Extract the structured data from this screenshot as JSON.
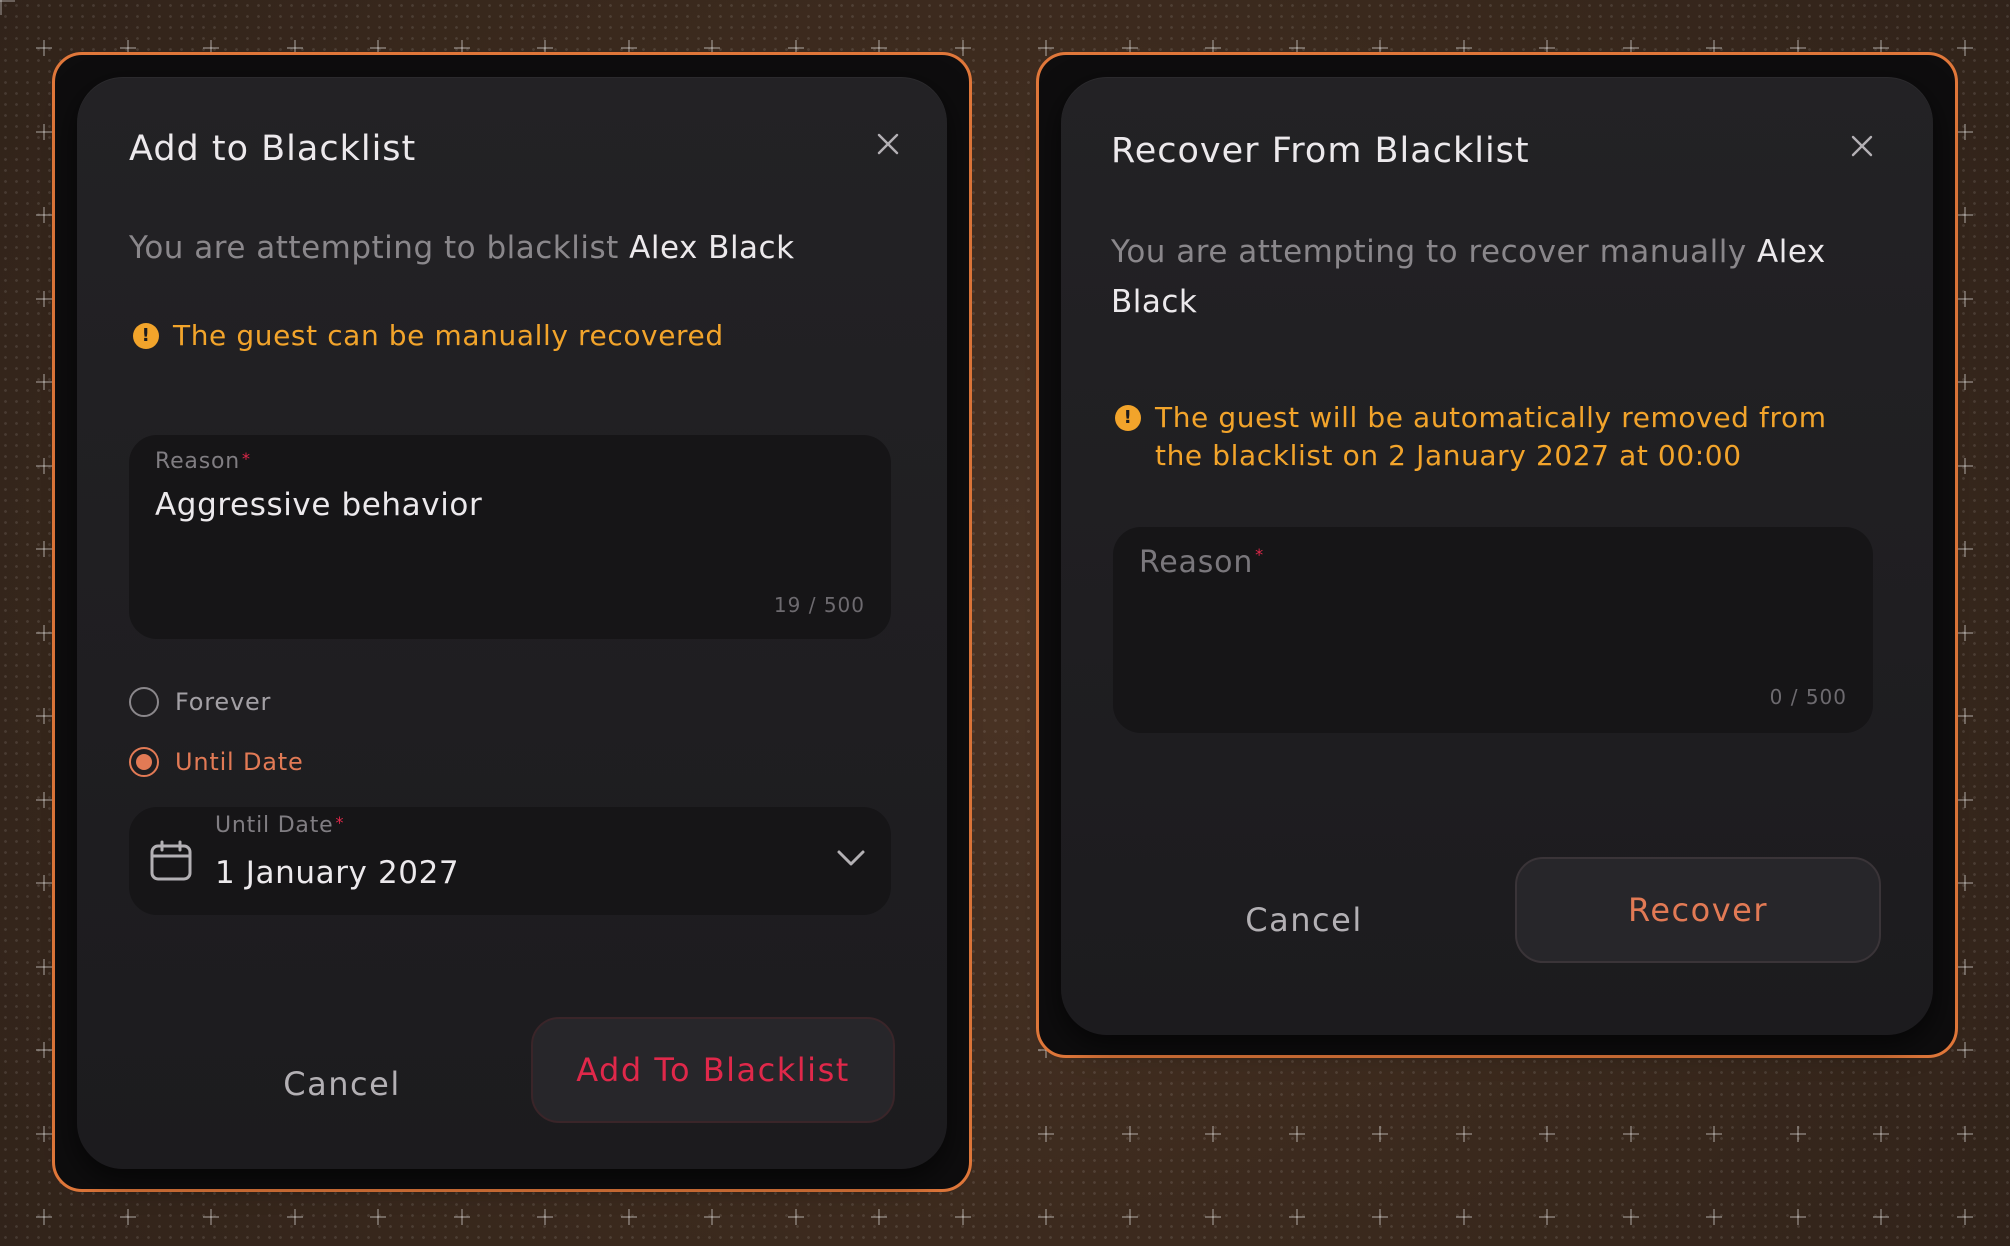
{
  "add_dialog": {
    "title": "Add to Blacklist",
    "subtitle_prefix": "You are attempting to blacklist ",
    "guest_name": "Alex Black",
    "warning": "The guest can be manually recovered",
    "reason": {
      "label": "Reason",
      "required_mark": "*",
      "value": "Aggressive behavior",
      "counter": "19 / 500"
    },
    "duration_options": [
      {
        "label": "Forever",
        "selected": false
      },
      {
        "label": "Until Date",
        "selected": true
      }
    ],
    "until_date": {
      "label": "Until Date",
      "required_mark": "*",
      "value": "1 January 2027"
    },
    "cancel_label": "Cancel",
    "submit_label": "Add To Blacklist"
  },
  "recover_dialog": {
    "title": "Recover From Blacklist",
    "subtitle_prefix": "You are attempting to recover manually ",
    "guest_name_line1": "Alex",
    "guest_name_line2": "Black",
    "warning_line1": "The guest will be automatically removed from",
    "warning_line2": "the blacklist on 2 January 2027 at 00:00",
    "reason": {
      "label": "Reason",
      "required_mark": "*",
      "value": "",
      "counter": "0 / 500"
    },
    "cancel_label": "Cancel",
    "submit_label": "Recover"
  },
  "colors": {
    "frame_border": "#e0773a",
    "warning": "#f2a42b",
    "accent": "#e27a55",
    "danger": "#e0284a",
    "dialog_bg": "#1f1e21",
    "field_bg": "#161517"
  },
  "icons": {
    "close": "close-icon",
    "warning": "warning-icon",
    "calendar": "calendar-icon",
    "dropdown": "chevron-down-icon"
  }
}
